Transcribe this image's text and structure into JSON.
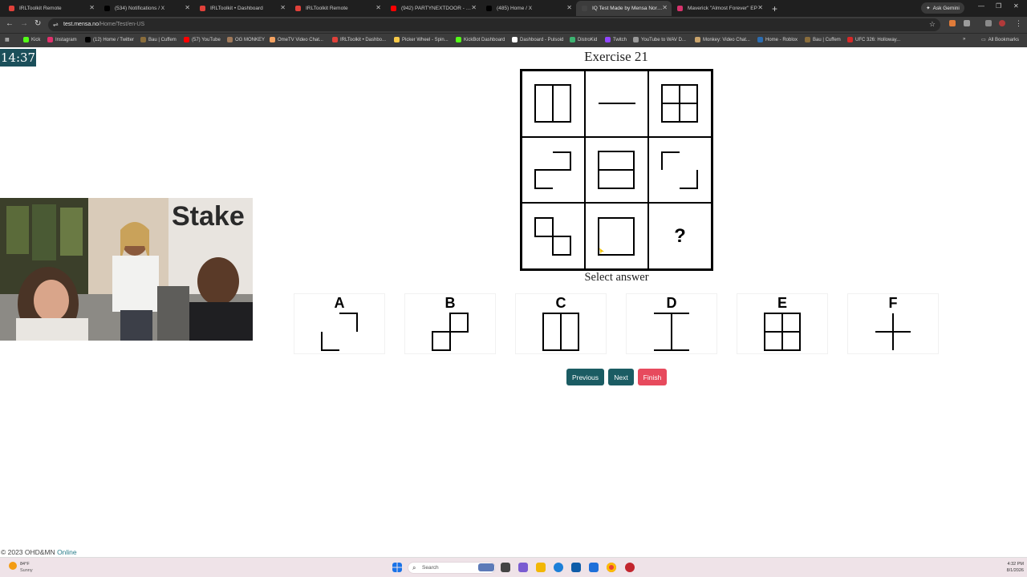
{
  "browser": {
    "tabs": [
      {
        "label": "IRLToolkit Remote",
        "color": "#e0413a"
      },
      {
        "label": "(534) Notifications / X",
        "color": "#000000"
      },
      {
        "label": "IRLToolkit • Dashboard",
        "color": "#e0413a"
      },
      {
        "label": "IRLToolkit Remote",
        "color": "#e0413a"
      },
      {
        "label": "(942) PARTYNEXTDOOR - Only",
        "color": "#ff0000"
      },
      {
        "label": "(485) Home / X",
        "color": "#000000"
      },
      {
        "label": "IQ Test Made by Mensa Norwa",
        "color": "#444444"
      },
      {
        "label": "Maverick \"Almost Forever\" EP",
        "color": "#d6336c"
      }
    ],
    "new_tab_glyph": "+",
    "ask_gemini": "Ask Gemini",
    "url_domain": "test.mensa.no",
    "url_path": "/Home/Test/en-US",
    "all_bookmarks": "All Bookmarks",
    "bookmarks": [
      {
        "label": "Kick",
        "color": "#53fc18"
      },
      {
        "label": "Instagram",
        "color": "#e1306c"
      },
      {
        "label": "(12) Home / Twitter",
        "color": "#000000"
      },
      {
        "label": "Bau | Cuffem",
        "color": "#8a6d3b"
      },
      {
        "label": "(57) YouTube",
        "color": "#ff0000"
      },
      {
        "label": "OG MONKEY",
        "color": "#a0795a"
      },
      {
        "label": "OmeTV Video Chat...",
        "color": "#f4a261"
      },
      {
        "label": "IRLToolkit • Dashbo...",
        "color": "#e0413a"
      },
      {
        "label": "Picker Wheel - Spin...",
        "color": "#f7c948"
      },
      {
        "label": "KickBot Dashboard",
        "color": "#53fc18"
      },
      {
        "label": "Dashboard - Pulsoid",
        "color": "#ffffff"
      },
      {
        "label": "DistroKid",
        "color": "#3cb371"
      },
      {
        "label": "Twitch",
        "color": "#9146ff"
      },
      {
        "label": "YouTube to WAV D...",
        "color": "#999999"
      },
      {
        "label": "Monkey: Video Chat...",
        "color": "#c9a36b"
      },
      {
        "label": "Home - Roblox",
        "color": "#2b6cb0"
      },
      {
        "label": "Bau | Cuffem",
        "color": "#8a6d3b"
      },
      {
        "label": "UFC 326: Holloway...",
        "color": "#d62828"
      }
    ]
  },
  "timer": "14:37",
  "exercise": {
    "title": "Exercise 21",
    "select_label": "Select answer",
    "question_mark": "?",
    "answers": [
      "A",
      "B",
      "C",
      "D",
      "E",
      "F"
    ]
  },
  "nav": {
    "previous": "Previous",
    "next": "Next",
    "finish": "Finish",
    "finish_color": "#e74a5d",
    "primary_color": "#1b5c63"
  },
  "footer": {
    "copyright": "© 2023 OHD&MN",
    "link": "Online"
  },
  "taskbar": {
    "weather_temp": "84°F",
    "weather_desc": "Sunny",
    "search_placeholder": "Search",
    "time": "4:32 PM",
    "date": "8/1/2026"
  }
}
